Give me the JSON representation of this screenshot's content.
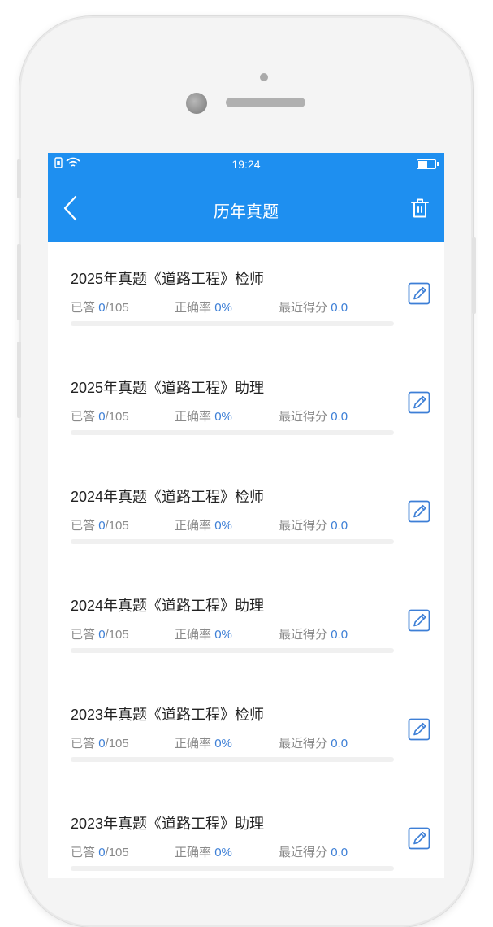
{
  "status_bar": {
    "time": "19:24",
    "battery_level": 0.55
  },
  "header": {
    "title": "历年真题",
    "back_icon": "chevron-left-icon",
    "delete_icon": "trash-icon"
  },
  "labels": {
    "answered": "已答",
    "accuracy": "正确率",
    "recent_score": "最近得分"
  },
  "colors": {
    "primary": "#1e8ff0",
    "value": "#3d7fd6",
    "muted": "#8a8a8a"
  },
  "papers": [
    {
      "title": "2025年真题《道路工程》检师",
      "answered": "0",
      "total": "/105",
      "accuracy": "0%",
      "score": "0.0",
      "progress": 0
    },
    {
      "title": "2025年真题《道路工程》助理",
      "answered": "0",
      "total": "/105",
      "accuracy": "0%",
      "score": "0.0",
      "progress": 0
    },
    {
      "title": "2024年真题《道路工程》检师",
      "answered": "0",
      "total": "/105",
      "accuracy": "0%",
      "score": "0.0",
      "progress": 0
    },
    {
      "title": "2024年真题《道路工程》助理",
      "answered": "0",
      "total": "/105",
      "accuracy": "0%",
      "score": "0.0",
      "progress": 0
    },
    {
      "title": "2023年真题《道路工程》检师",
      "answered": "0",
      "total": "/105",
      "accuracy": "0%",
      "score": "0.0",
      "progress": 0
    },
    {
      "title": "2023年真题《道路工程》助理",
      "answered": "0",
      "total": "/105",
      "accuracy": "0%",
      "score": "0.0",
      "progress": 0
    }
  ]
}
